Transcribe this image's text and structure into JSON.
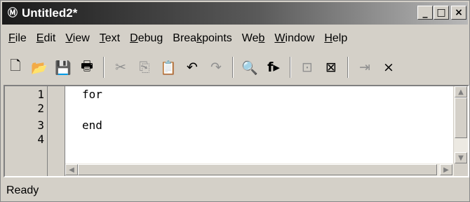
{
  "window": {
    "title": "Untitled2*",
    "app_icon": "matlab-editor-icon",
    "minimize_glyph": "_",
    "maximize_glyph": "□",
    "close_glyph": "×"
  },
  "menu": [
    {
      "label": "File",
      "key": "F"
    },
    {
      "label": "Edit",
      "key": "E"
    },
    {
      "label": "View",
      "key": "V"
    },
    {
      "label": "Text",
      "key": "T"
    },
    {
      "label": "Debug",
      "key": "D"
    },
    {
      "label": "Breakpoints",
      "key": "k"
    },
    {
      "label": "Web",
      "key": "b"
    },
    {
      "label": "Window",
      "key": "W"
    },
    {
      "label": "Help",
      "key": "H"
    }
  ],
  "toolbar": {
    "new": "🗋",
    "open": "📂",
    "save": "💾",
    "print": "🖶",
    "cut": "✂",
    "copy": "⎘",
    "paste": "📋",
    "undo": "↶",
    "redo": "↷",
    "find": "🔍",
    "function": "f▸",
    "set_breakpoint": "⊡",
    "clear_breakpoints": "⊠",
    "step": "⇥",
    "exit_debug": "×"
  },
  "editor": {
    "lines": [
      {
        "number": "1",
        "text": "for"
      },
      {
        "number": "2",
        "text": ""
      },
      {
        "number": "3",
        "text": "end"
      },
      {
        "number": "4",
        "text": ""
      }
    ]
  },
  "status": {
    "text": "Ready"
  }
}
